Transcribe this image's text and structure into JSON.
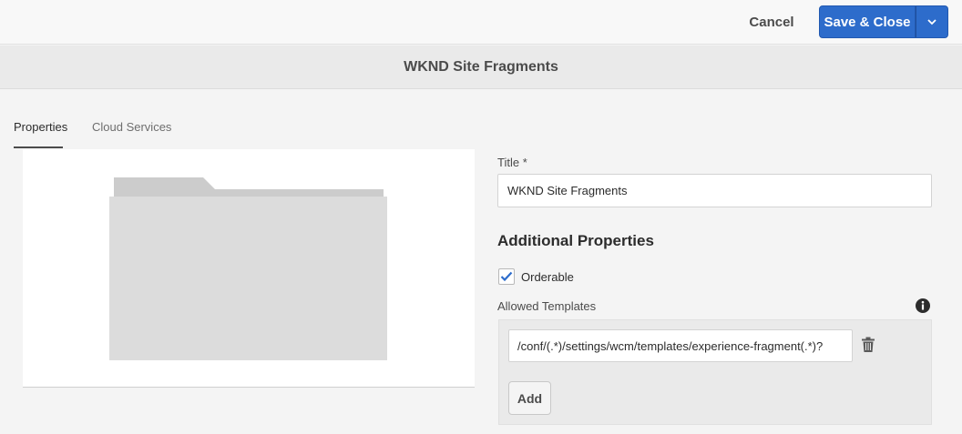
{
  "toolbar": {
    "cancel_label": "Cancel",
    "save_label": "Save & Close",
    "dropdown_icon": "chevron-down-icon"
  },
  "page": {
    "title": "WKND Site Fragments"
  },
  "tabs": [
    {
      "label": "Properties",
      "active": true
    },
    {
      "label": "Cloud Services",
      "active": false
    }
  ],
  "thumbnail": {
    "icon": "folder-icon"
  },
  "form": {
    "title_label": "Title *",
    "title_value": "WKND Site Fragments",
    "additional_heading": "Additional Properties",
    "orderable_label": "Orderable",
    "orderable_checked": true,
    "allowed_templates_label": "Allowed Templates",
    "info_icon": "info-icon",
    "template_value": "/conf/(.*)/settings/wcm/templates/experience-fragment(.*)?",
    "delete_icon": "trash-icon",
    "add_label": "Add"
  },
  "colors": {
    "accent": "#2d6ccb",
    "background": "#f4f4f4",
    "folder": "#dcdcdc"
  }
}
